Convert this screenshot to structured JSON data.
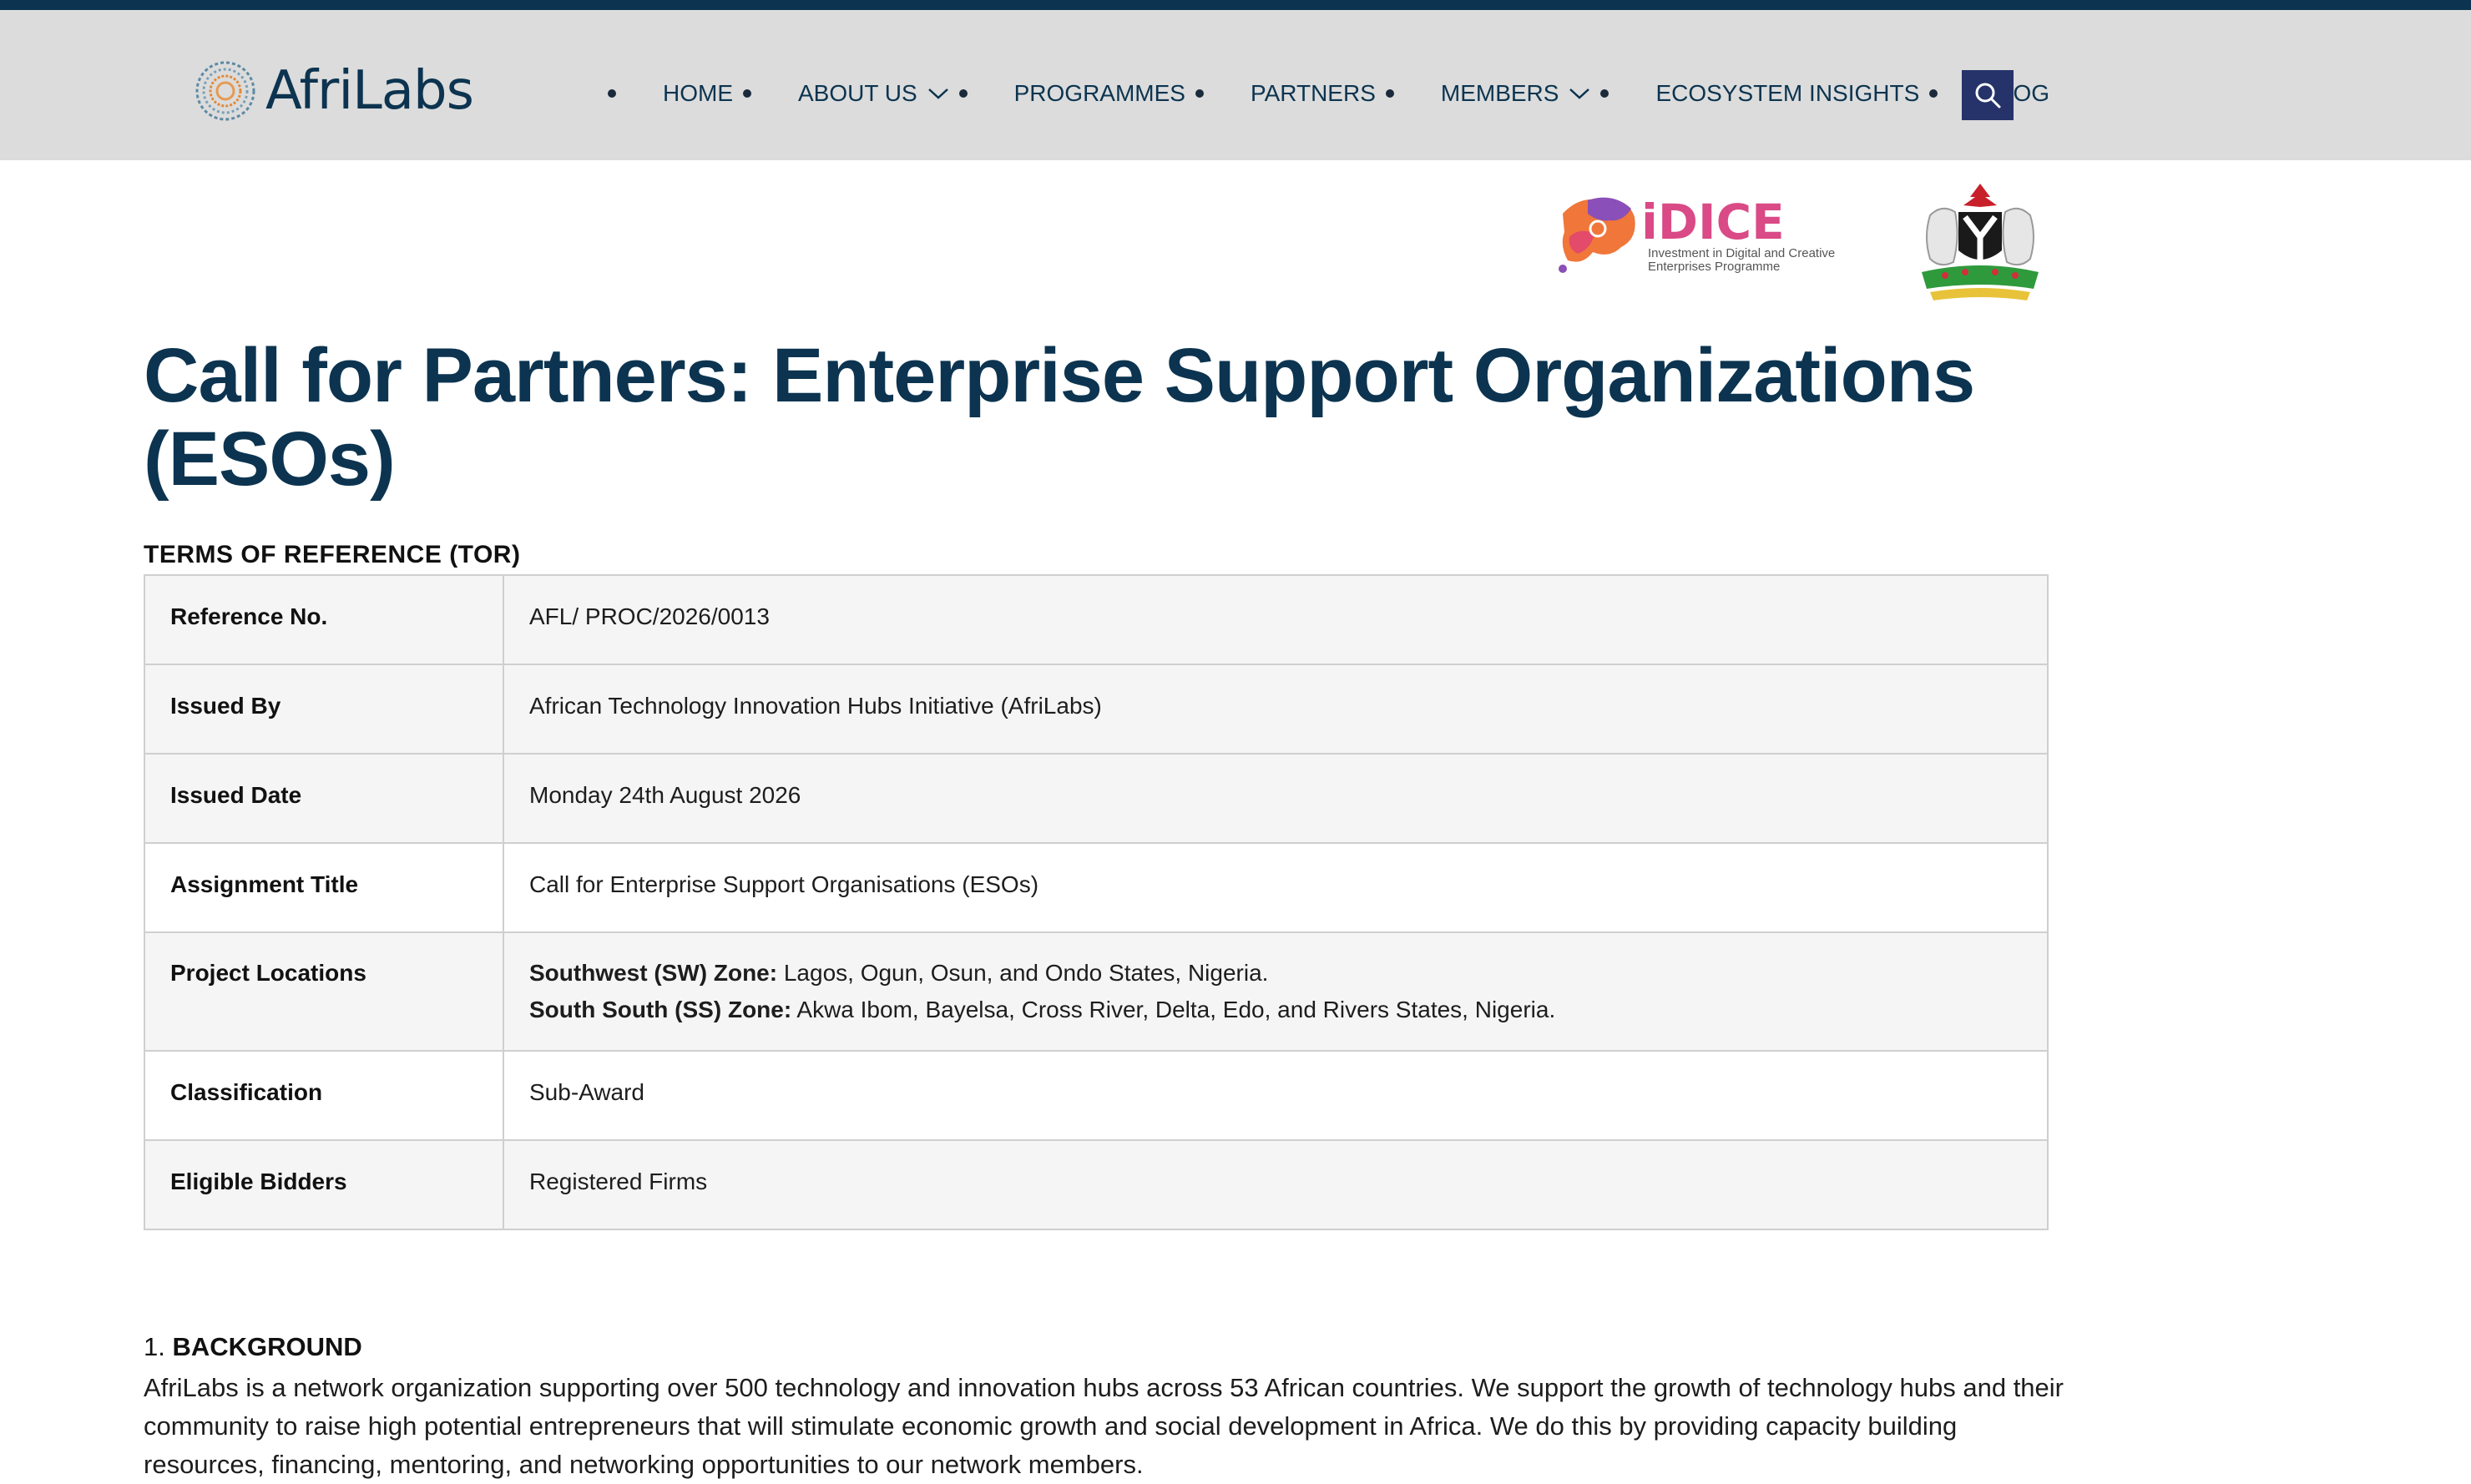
{
  "header": {
    "logo_text": "AfriLabs",
    "nav": [
      {
        "label": "HOME",
        "dropdown": false
      },
      {
        "label": "ABOUT US",
        "dropdown": true
      },
      {
        "label": "PROGRAMMES",
        "dropdown": false
      },
      {
        "label": "PARTNERS",
        "dropdown": false
      },
      {
        "label": "MEMBERS",
        "dropdown": true
      },
      {
        "label": "ECOSYSTEM INSIGHTS",
        "dropdown": false
      },
      {
        "label": "BLOG",
        "dropdown": false
      }
    ],
    "search_icon": "search-icon"
  },
  "partner_logos": {
    "idice_title": "iDICE",
    "idice_line1": "Investment in Digital and Creative",
    "idice_line2": "Enterprises Programme"
  },
  "page": {
    "title": "Call for Partners: Enterprise Support Organizations (ESOs)",
    "tor_heading": "TERMS OF REFERENCE (TOR)"
  },
  "tor": [
    {
      "label": "Reference No.",
      "value": "AFL/ PROC/2026/0013"
    },
    {
      "label": "Issued By",
      "value": "African Technology Innovation Hubs Initiative (AfriLabs)"
    },
    {
      "label": "Issued Date",
      "value": "Monday 24th August 2026"
    },
    {
      "label": "Assignment Title",
      "value": "Call for Enterprise Support Organisations (ESOs)"
    },
    {
      "label": "Project Locations",
      "line1_bold": "Southwest (SW) Zone:",
      "line1_text": " Lagos, Ogun, Osun, and Ondo States, Nigeria.",
      "line2_bold": "South South (SS) Zone:",
      "line2_text": " Akwa Ibom, Bayelsa, Cross River, Delta, Edo, and Rivers States, Nigeria."
    },
    {
      "label": "Classification",
      "value": "Sub-Award"
    },
    {
      "label": "Eligible Bidders",
      "value": "Registered Firms"
    }
  ],
  "background": {
    "number": "1.",
    "heading": "BACKGROUND",
    "text": "AfriLabs is a network organization supporting over 500 technology and innovation hubs across 53 African countries. We support the growth of technology hubs and their community to raise high potential entrepreneurs that will stimulate economic growth and social development in Africa. We do this by providing capacity building resources, financing, mentoring, and networking opportunities to our network members."
  },
  "colors": {
    "brand_navy": "#0c3450",
    "search_bg": "#26336a",
    "header_bg": "#dcdcdc"
  }
}
